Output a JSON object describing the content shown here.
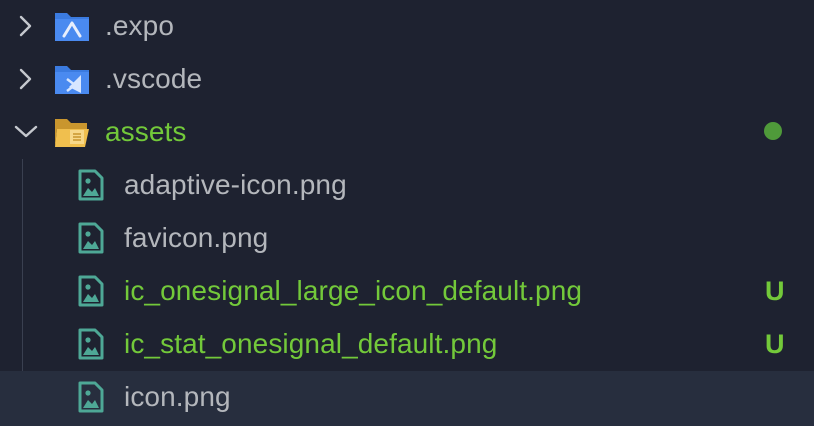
{
  "explorer": {
    "items": [
      {
        "kind": "folder",
        "label": ".expo",
        "expanded": false,
        "icon": "expo-folder-icon"
      },
      {
        "kind": "folder",
        "label": ".vscode",
        "expanded": false,
        "icon": "vscode-folder-icon"
      },
      {
        "kind": "folder",
        "label": "assets",
        "expanded": true,
        "icon": "assets-folder-open-icon",
        "git_state": "modified"
      },
      {
        "kind": "file",
        "label": "adaptive-icon.png",
        "icon": "image-file-icon"
      },
      {
        "kind": "file",
        "label": "favicon.png",
        "icon": "image-file-icon"
      },
      {
        "kind": "file",
        "label": "ic_onesignal_large_icon_default.png",
        "icon": "image-file-icon",
        "status": "U"
      },
      {
        "kind": "file",
        "label": "ic_stat_onesignal_default.png",
        "icon": "image-file-icon",
        "status": "U"
      },
      {
        "kind": "file",
        "label": "icon.png",
        "icon": "image-file-icon",
        "selected": true
      }
    ]
  },
  "colors": {
    "background": "#1e2230",
    "selected_row": "#272e3e",
    "text": "#b4b7bc",
    "git_untracked": "#73c93a",
    "git_modified_dot": "#4f9a3a",
    "expo_folder": "#3b7be0",
    "vscode_folder": "#3b7be0",
    "assets_folder": "#e8b84a",
    "image_icon": "#4ea896"
  }
}
